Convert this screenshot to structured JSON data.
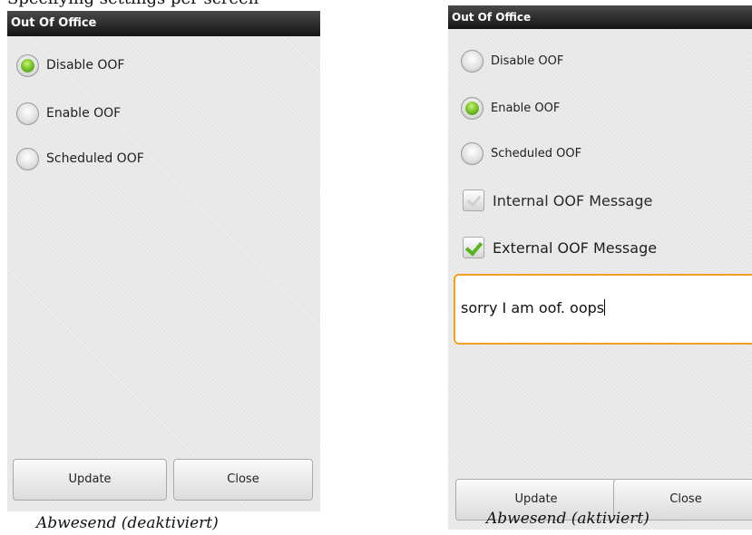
{
  "top_clipped_text": "Specifying settings per screen",
  "left_screen": {
    "title": "Out Of Office",
    "options": [
      {
        "label": "Disable OOF",
        "selected": true
      },
      {
        "label": "Enable OOF",
        "selected": false
      },
      {
        "label": "Scheduled OOF",
        "selected": false
      }
    ],
    "buttons": {
      "update": "Update",
      "close": "Close"
    }
  },
  "right_screen": {
    "title": "Out Of Office",
    "options": [
      {
        "label": "Disable OOF",
        "selected": false
      },
      {
        "label": "Enable OOF",
        "selected": true
      },
      {
        "label": "Scheduled OOF",
        "selected": false
      }
    ],
    "checkboxes": [
      {
        "label": "Internal OOF Message",
        "checked": false
      },
      {
        "label": "External OOF Message",
        "checked": true
      }
    ],
    "message": "sorry I am oof. oops",
    "buttons": {
      "update": "Update",
      "close": "Close"
    }
  },
  "captions": {
    "left": "Abwesend (deaktiviert)",
    "right": "Abwesend (aktiviert)"
  },
  "colors": {
    "title_bar": "#1e1e1e",
    "radio_selected": "#7bc62b",
    "check_mark": "#58b51f",
    "text_focus_border": "#f0a020"
  }
}
